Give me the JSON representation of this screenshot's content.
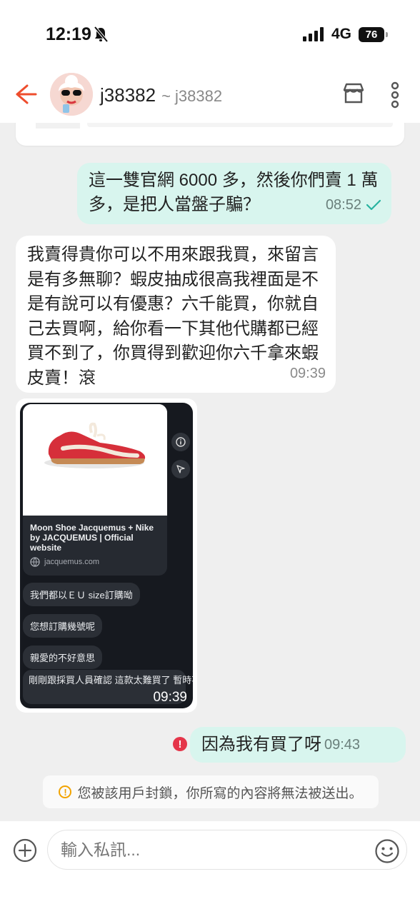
{
  "status": {
    "time": "12:19",
    "network": "4G",
    "battery": "76"
  },
  "header": {
    "username": "j38382",
    "nickname": "~ j38382"
  },
  "messages": [
    {
      "text": "這一雙官網 6000 多，然後你們賣 1 萬多，是把人當盤子騙？",
      "time": "08:52"
    },
    {
      "text": "我賣得貴你可以不用來跟我買，來留言是有多無聊？蝦皮抽成很高我裡面是不是有說可以有優惠？六千能買，你就自己去買啊，給你看一下其他代購都已經買不到了，你買得到歡迎你六千拿來蝦皮賣！滾",
      "time": "09:39"
    },
    {
      "text": "因為我有買了呀",
      "time": "09:43"
    }
  ],
  "image_message": {
    "link_title": "Moon Shoe Jacquemus + Nike by JACQUEMUS | Official website",
    "link_domain": "jacquemus.com",
    "pills": [
      "我們都以ＥＵ size訂購呦",
      "您想訂購幾號呢",
      "親愛的不好意思"
    ],
    "last_bubble": "剛剛跟採買人員確認 這款太難買了 暫時不收單唷🙏🏼",
    "time": "09:39"
  },
  "notice": "您被該用戶封鎖，你所寫的內容將無法被送出。",
  "input": {
    "placeholder": "輸入私訊..."
  },
  "colors": {
    "accent": "#ee4d2d",
    "outgoing_bubble": "#d8f5ee",
    "error": "#e5354a",
    "warning": "#f2a300"
  }
}
